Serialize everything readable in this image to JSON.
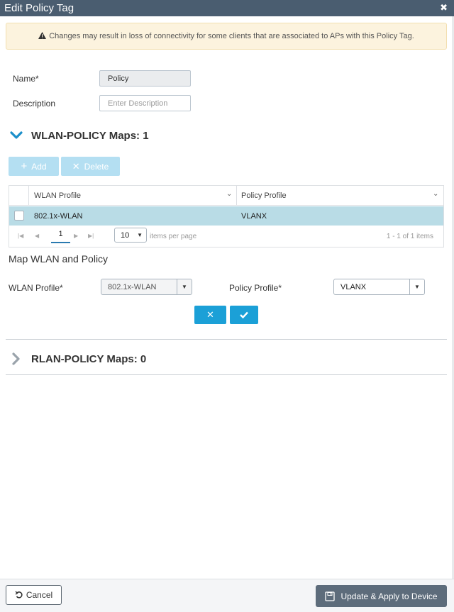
{
  "dialog": {
    "title": "Edit Policy Tag",
    "close_glyph": "✖"
  },
  "warning": {
    "icon": "warning-triangle-icon",
    "text": "Changes may result in loss of connectivity for some clients that are associated to APs with this Policy Tag."
  },
  "form": {
    "name_label": "Name*",
    "name_value": "Policy",
    "description_label": "Description",
    "description_placeholder": "Enter Description"
  },
  "wlan_section": {
    "title": "WLAN-POLICY Maps: 1",
    "add_label": "Add",
    "delete_label": "Delete",
    "columns": [
      "WLAN Profile",
      "Policy Profile"
    ],
    "rows": [
      {
        "wlan_profile": "802.1x-WLAN",
        "policy_profile": "VLANX"
      }
    ],
    "pager": {
      "page": "1",
      "page_size": "10",
      "items_per_page_label": "items per page",
      "count_text": "1 - 1 of 1 items"
    }
  },
  "map_section": {
    "title": "Map WLAN and Policy",
    "wlan_profile_label": "WLAN Profile*",
    "wlan_profile_value": "802.1x-WLAN",
    "policy_profile_label": "Policy Profile*",
    "policy_profile_value": "VLANX"
  },
  "rlan_section": {
    "title": "RLAN-POLICY Maps: 0"
  },
  "footer": {
    "cancel_label": "Cancel",
    "update_label": "Update & Apply to Device"
  },
  "colors": {
    "titlebar": "#4a5d70",
    "accent": "#1ba0d7",
    "selected_row": "#b9dce6",
    "warning_bg": "#fcf3de"
  }
}
